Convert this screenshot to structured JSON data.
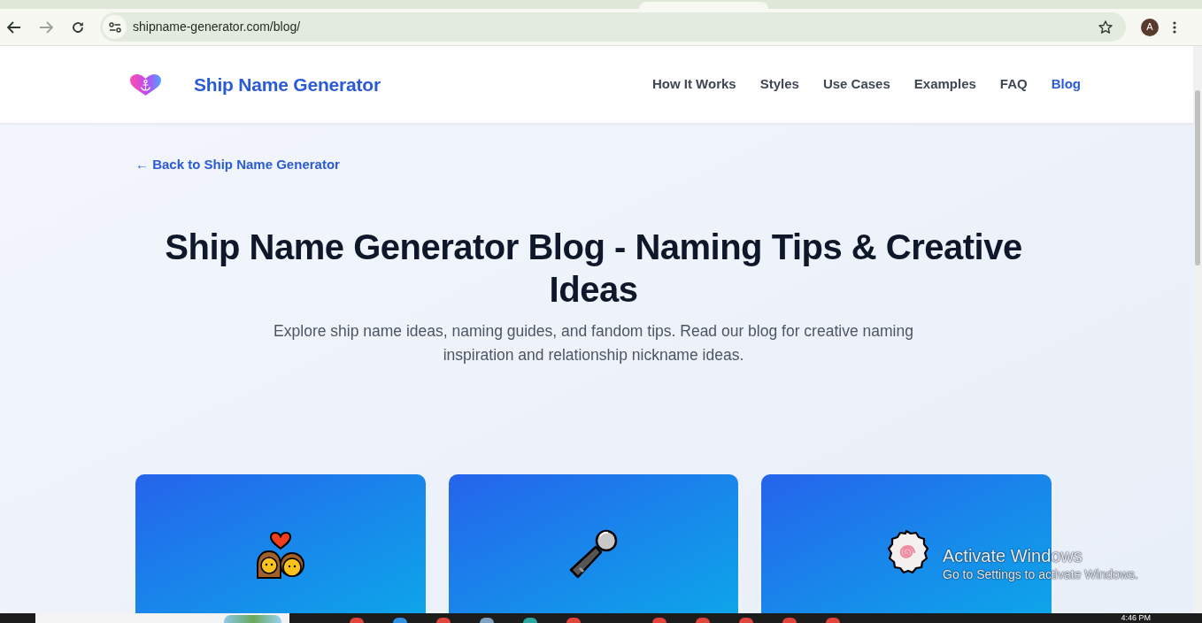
{
  "browser": {
    "back_disabled": false,
    "forward_disabled": true,
    "url": "shipname-generator.com/blog/",
    "profile_initial": "A"
  },
  "header": {
    "brand": "Ship Name Generator",
    "nav": [
      {
        "label": "How It Works",
        "selected": false
      },
      {
        "label": "Styles",
        "selected": false
      },
      {
        "label": "Use Cases",
        "selected": false
      },
      {
        "label": "Examples",
        "selected": false
      },
      {
        "label": "FAQ",
        "selected": false
      },
      {
        "label": "Blog",
        "selected": true
      }
    ]
  },
  "back_link": "← Back to Ship Name Generator",
  "hero": {
    "title": "Ship Name Generator Blog - Naming Tips & Creative Ideas",
    "subtitle": "Explore ship name ideas, naming guides, and fandom tips. Read our blog for creative naming inspiration and relationship nickname ideas."
  },
  "cards": [
    {
      "kind": "couple"
    },
    {
      "kind": "microphone"
    },
    {
      "kind": "fish-cake"
    }
  ],
  "activation_notice": {
    "title": "Activate Windows",
    "text": "Go to Settings to activate Windows."
  },
  "taskbar": {
    "clock": "4:46 PM"
  }
}
